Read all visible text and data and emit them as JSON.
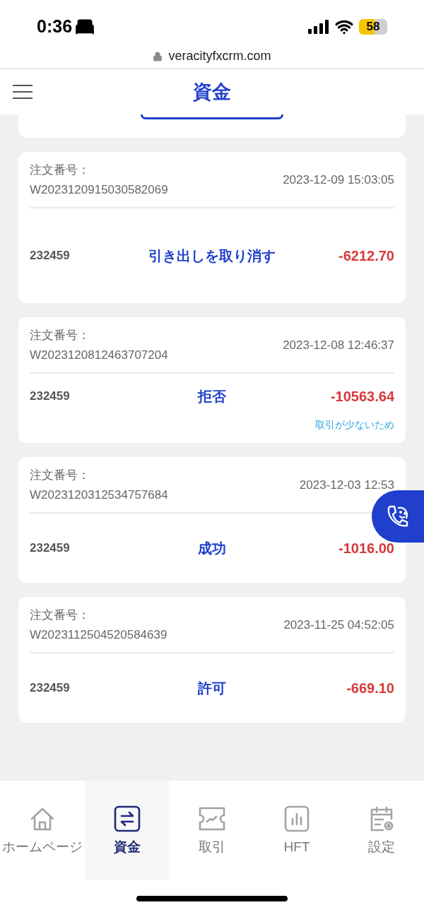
{
  "status_bar": {
    "time": "0:36",
    "battery": "58"
  },
  "browser": {
    "url": "veracityfxcrm.com"
  },
  "header": {
    "title": "資金"
  },
  "orders": [
    {
      "label": "注文番号：",
      "number": "W2023120915030582069",
      "date": "2023-12-09 15:03:05",
      "account": "232459",
      "status": "引き出しを取り消す",
      "amount": "-6212.70"
    },
    {
      "label": "注文番号：",
      "number": "W2023120812463707204",
      "date": "2023-12-08 12:46:37",
      "account": "232459",
      "status": "拒否",
      "amount": "-10563.64",
      "note": "取引が少ないため"
    },
    {
      "label": "注文番号：",
      "number": "W2023120312534757684",
      "date": "2023-12-03 12:53",
      "account": "232459",
      "status": "成功",
      "amount": "-1016.00"
    },
    {
      "label": "注文番号：",
      "number": "W2023112504520584639",
      "date": "2023-11-25 04:52:05",
      "account": "232459",
      "status": "許可",
      "amount": "-669.10"
    }
  ],
  "nav": [
    {
      "kind": "home",
      "label": "ホームページ",
      "selected": false
    },
    {
      "kind": "funds",
      "label": "資金",
      "selected": true
    },
    {
      "kind": "trade",
      "label": "取引",
      "selected": false
    },
    {
      "kind": "hft",
      "label": "HFT",
      "selected": false
    },
    {
      "kind": "settings",
      "label": "設定",
      "selected": false
    }
  ]
}
